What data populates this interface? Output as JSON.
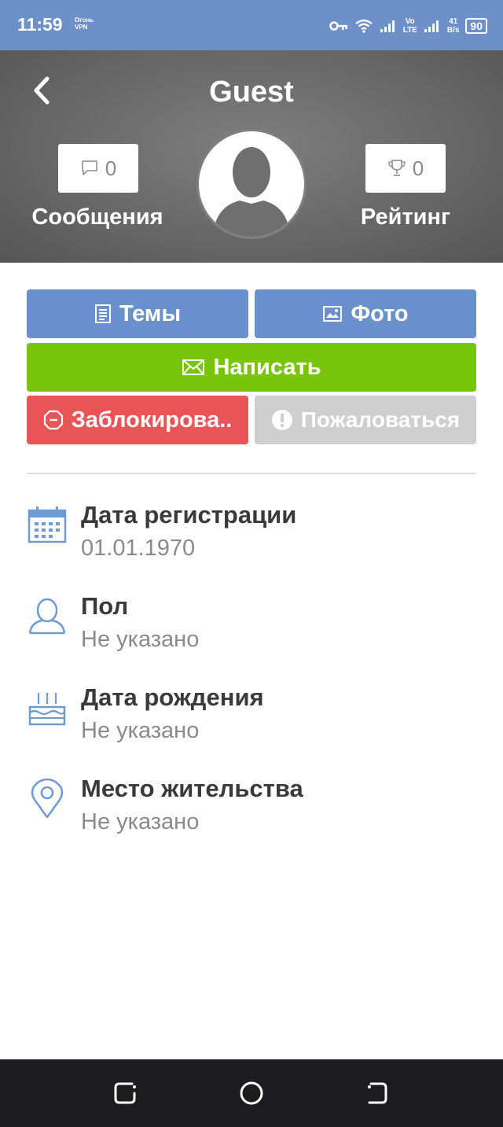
{
  "status_bar": {
    "time": "11:59",
    "vpn_label_top": "Огонь",
    "vpn_label_bottom": "VPN",
    "lte_top": "Vo",
    "lte_bottom": "LTE",
    "speed_value": "41",
    "speed_unit": "B/s",
    "battery": "90"
  },
  "header": {
    "title": "Guest",
    "messages": {
      "count": "0",
      "label": "Сообщения",
      "icon": "chat-bubble-icon"
    },
    "rating": {
      "count": "0",
      "label": "Рейтинг",
      "icon": "trophy-icon"
    },
    "avatar_icon": "user-silhouette-icon"
  },
  "actions": {
    "topics": "Темы",
    "photo": "Фото",
    "write": "Написать",
    "block": "Заблокирова..",
    "report": "Пожаловаться"
  },
  "info": [
    {
      "title": "Дата регистрации",
      "value": "01.01.1970",
      "icon": "calendar-icon"
    },
    {
      "title": "Пол",
      "value": "Не указано",
      "icon": "person-icon"
    },
    {
      "title": "Дата рождения",
      "value": "Не указано",
      "icon": "cake-icon"
    },
    {
      "title": "Место жительства",
      "value": "Не указано",
      "icon": "location-pin-icon"
    }
  ],
  "colors": {
    "status_bar": "#6e90c8",
    "header_bg": "#686868",
    "blue_button": "#6a91cd",
    "green_button": "#79c50c",
    "red_button": "#e85458",
    "grey_button": "#cfcfcf",
    "icon_blue": "#6f9bd1"
  }
}
